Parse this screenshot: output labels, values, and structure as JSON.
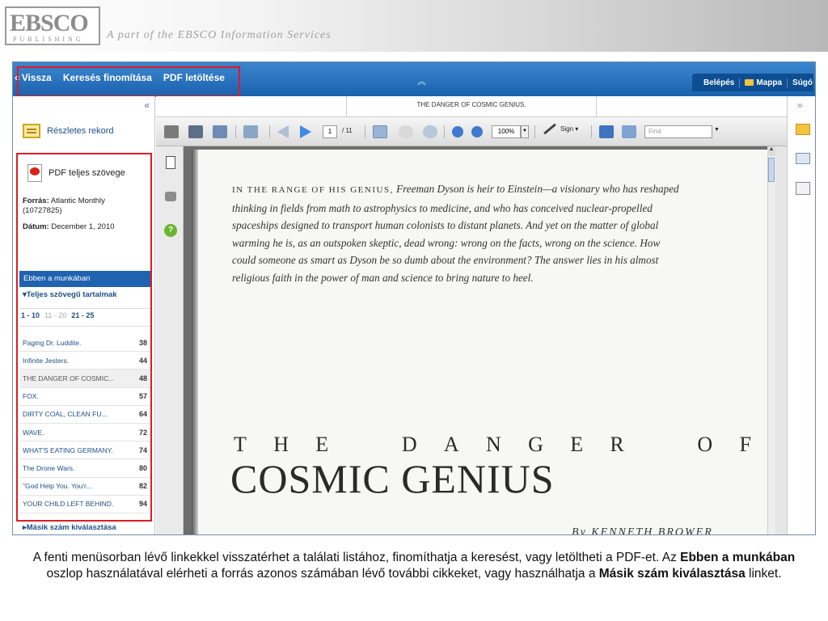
{
  "banner": {
    "logo_main": "EBSCO",
    "logo_sub": "PUBLISHING",
    "tagline": "A part of the EBSCO Information Services"
  },
  "topnav": {
    "back_glyph": "«",
    "links": [
      "Vissza",
      "Keresés finomítása",
      "PDF letöltése"
    ],
    "collapse_icon": "double-chevron-up-icon",
    "right_links": [
      "Belépés",
      "Mappa",
      "Súgó"
    ]
  },
  "left_panel": {
    "collapse": "«",
    "detailed_record": "Részletes rekord",
    "full_text": "PDF teljes szövege",
    "source_label": "Forrás:",
    "source_value": "Atlantic Monthly (10727825)",
    "date_label": "Dátum:",
    "date_value": "December 1,  2010",
    "section_title": "Ebben a munkában",
    "toc_label": "▾Teljes szövegű tartalmak",
    "pager": [
      "1 - 10",
      "11 - 20",
      "21 - 25"
    ],
    "articles": [
      {
        "title": "Paging Dr. Luddite.",
        "page": "38"
      },
      {
        "title": "Infinite Jesters.",
        "page": "44"
      },
      {
        "title": "THE DANGER OF COSMIC...",
        "page": "48"
      },
      {
        "title": "FOX.",
        "page": "57"
      },
      {
        "title": "DIRTY COAL, CLEAN FU...",
        "page": "64"
      },
      {
        "title": "WAVE.",
        "page": "72"
      },
      {
        "title": "WHAT'S EATING GERMANY.",
        "page": "74"
      },
      {
        "title": "The Drone Wars.",
        "page": "80"
      },
      {
        "title": "\"God Help You. You'r...",
        "page": "82"
      },
      {
        "title": "YOUR CHILD LEFT BEHIND.",
        "page": "94"
      }
    ],
    "other_issue": "▸Másik szám kiválasztása"
  },
  "viewer": {
    "doc_title": "THE DANGER OF COSMIC GENIUS.",
    "page_current": "1",
    "page_total": "/ 11",
    "zoom": "100%",
    "sign_label": "Sign ▾",
    "find_placeholder": "Find"
  },
  "page_content": {
    "intro_lead": "IN THE RANGE OF HIS GENIUS,",
    "intro_text": "Freeman Dyson is heir to Einstein—a visionary who has reshaped thinking in fields from math to astrophysics to medicine, and who has conceived nuclear-propelled spaceships designed to transport human colonists to distant planets. And yet on the matter of global warming he is, as an outspoken skeptic, dead wrong: wrong on the facts, wrong on the science. How could someone as smart as Dyson be so dumb about the environment? The answer lies in his almost religious faith in the power of man and science to bring nature to heel.",
    "kicker_letters": [
      "T",
      "H",
      "E",
      "D",
      "A",
      "N",
      "G",
      "E",
      "R",
      "O",
      "F"
    ],
    "title": "COSMIC GENIUS",
    "byline": "By KENNETH BROWER"
  },
  "caption": {
    "part1": "A fenti menüsorban lévő linkekkel visszatérhet a találati listához, finomíthatja a keresést, vagy letöltheti a PDF-et. Az ",
    "bold1": "Ebben a munkában",
    "part2": " oszlop használatával elérheti a forrás azonos számában lévő további cikkeket, vagy használhatja a ",
    "bold2": "Másik szám kiválasztása",
    "part3": " linket."
  },
  "colors": {
    "nav_blue": "#1a62ae",
    "highlight_red": "#e01b24",
    "link_blue": "#1f4f87"
  }
}
